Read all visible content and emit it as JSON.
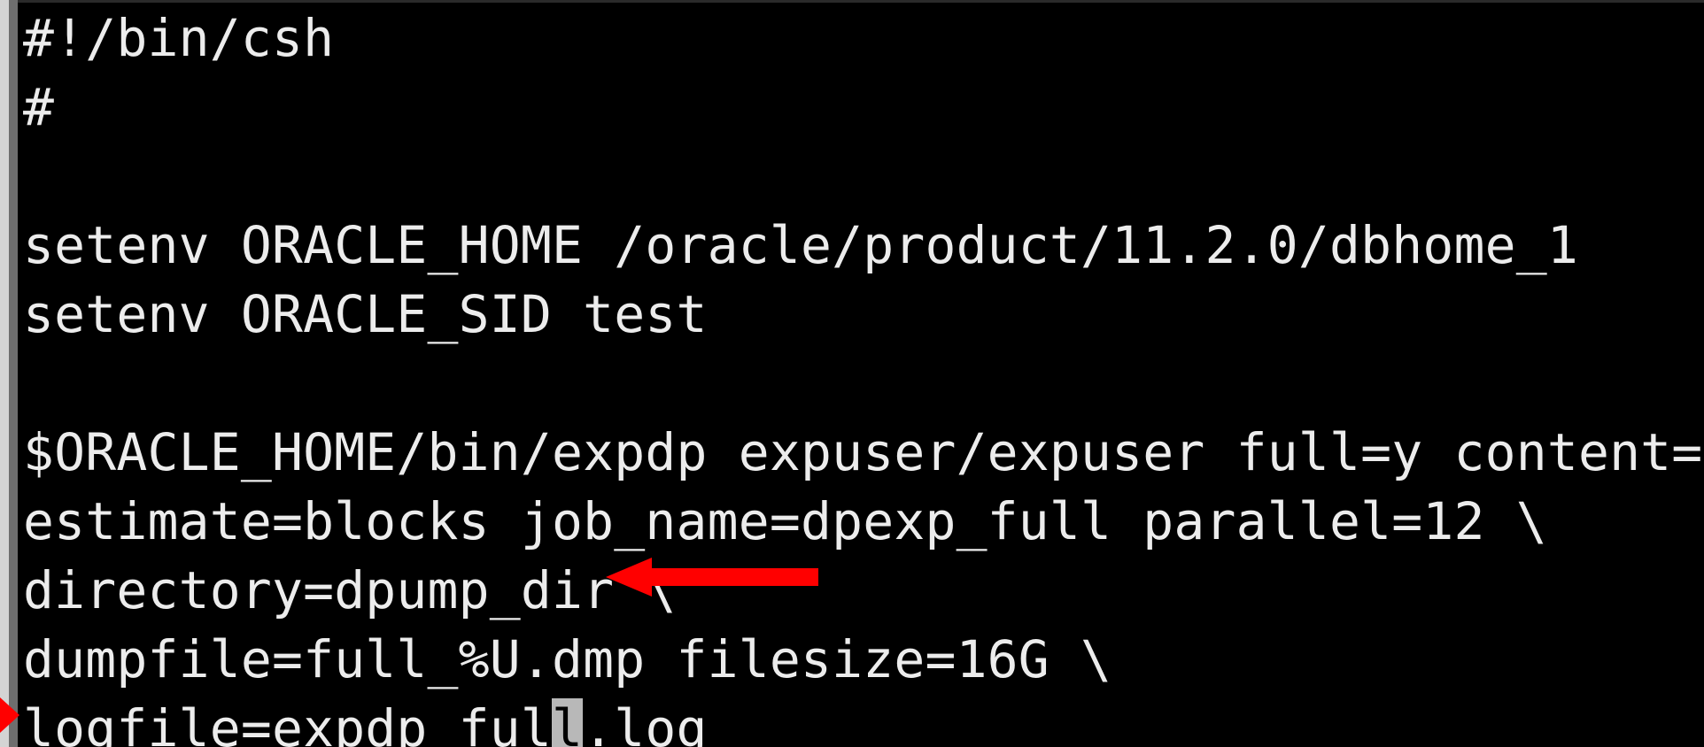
{
  "terminal": {
    "lines": [
      "#!/bin/csh",
      "#",
      "",
      "setenv ORACLE_HOME /oracle/product/11.2.0/dbhome_1",
      "setenv ORACLE_SID test",
      "",
      "$ORACLE_HOME/bin/expdp expuser/expuser full=y content=all \\",
      "estimate=blocks job_name=dpexp_full parallel=12 \\",
      "directory=dpump_dir \\",
      "dumpfile=full_%U.dmp filesize=16G \\"
    ],
    "last_line": {
      "before_cursor": "logfile=expdp_ful",
      "cursor_char": "l",
      "after_cursor": ".log"
    }
  },
  "annotations": {
    "arrow_color": "#ff0000",
    "marker_color": "#ff0000",
    "arrow_icon": "left-arrow-icon",
    "marker_icon": "right-triangle-icon"
  },
  "colors": {
    "background": "#000000",
    "text": "#ececec",
    "cursor": "#b8b8b8"
  }
}
